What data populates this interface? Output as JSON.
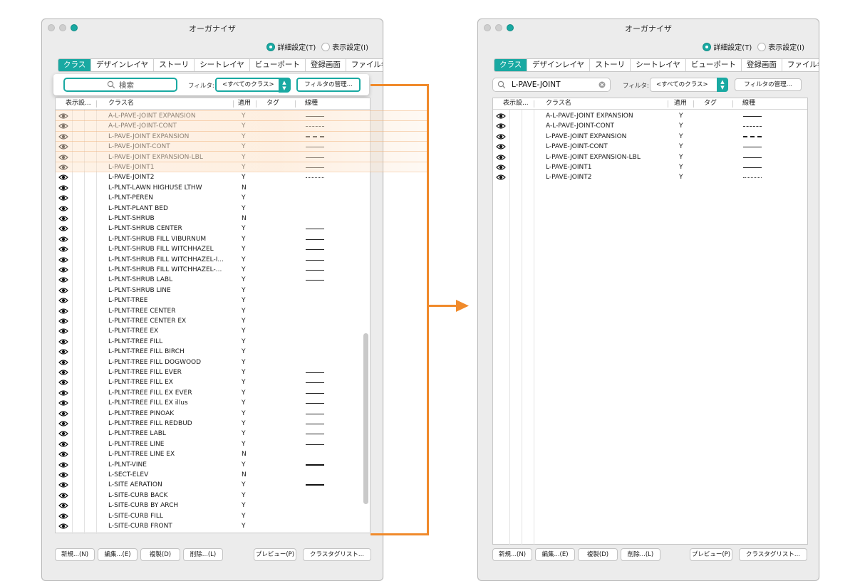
{
  "window_title": "オーガナイザ",
  "radio": {
    "detail": "詳細設定(T)",
    "display": "表示設定(I)"
  },
  "tabs": [
    "クラス",
    "デザインレイヤ",
    "ストーリ",
    "シートレイヤ",
    "ビューポート",
    "登録画面",
    "ファイル参照"
  ],
  "left": {
    "search_placeholder": "検索",
    "filter_label": "フィルタ:",
    "filter_value": "<すべてのクラス>",
    "manage_filter": "フィルタの管理...",
    "columns": {
      "visibility": "表示設...",
      "name": "クラス名",
      "apply": "適用",
      "tag": "タグ",
      "linetype": "線種"
    },
    "rows": [
      {
        "name": "A-L-PAVE-JOINT EXPANSION",
        "apply": "Y",
        "line": "solid"
      },
      {
        "name": "A-L-PAVE-JOINT-CONT",
        "apply": "Y",
        "line": "dash"
      },
      {
        "name": "L-PAVE-JOINT EXPANSION",
        "apply": "Y",
        "line": "dashb"
      },
      {
        "name": "L-PAVE-JOINT-CONT",
        "apply": "Y",
        "line": "solid"
      },
      {
        "name": "L-PAVE-JOINT EXPANSION-LBL",
        "apply": "Y",
        "line": "solid"
      },
      {
        "name": "L-PAVE-JOINT1",
        "apply": "Y",
        "line": "solid"
      },
      {
        "name": "L-PAVE-JOINT2",
        "apply": "Y",
        "line": "dot"
      },
      {
        "name": "L-PLNT-LAWN HIGHUSE LTHW",
        "apply": "N",
        "line": ""
      },
      {
        "name": "L-PLNT-PEREN",
        "apply": "Y",
        "line": ""
      },
      {
        "name": "L-PLNT-PLANT BED",
        "apply": "Y",
        "line": ""
      },
      {
        "name": "L-PLNT-SHRUB",
        "apply": "N",
        "line": ""
      },
      {
        "name": "L-PLNT-SHRUB CENTER",
        "apply": "Y",
        "line": "solid"
      },
      {
        "name": "L-PLNT-SHRUB FILL VIBURNUM",
        "apply": "Y",
        "line": "solid"
      },
      {
        "name": "L-PLNT-SHRUB FILL WITCHHAZEL",
        "apply": "Y",
        "line": "solid"
      },
      {
        "name": "L-PLNT-SHRUB FILL WITCHHAZEL-I...",
        "apply": "Y",
        "line": "solid"
      },
      {
        "name": "L-PLNT-SHRUB FILL WITCHHAZEL-...",
        "apply": "Y",
        "line": "solid"
      },
      {
        "name": "L-PLNT-SHRUB LABL",
        "apply": "Y",
        "line": "solid"
      },
      {
        "name": "L-PLNT-SHRUB LINE",
        "apply": "Y",
        "line": ""
      },
      {
        "name": "L-PLNT-TREE",
        "apply": "Y",
        "line": ""
      },
      {
        "name": "L-PLNT-TREE CENTER",
        "apply": "Y",
        "line": ""
      },
      {
        "name": "L-PLNT-TREE CENTER EX",
        "apply": "Y",
        "line": ""
      },
      {
        "name": "L-PLNT-TREE EX",
        "apply": "Y",
        "line": ""
      },
      {
        "name": "L-PLNT-TREE FILL",
        "apply": "Y",
        "line": ""
      },
      {
        "name": "L-PLNT-TREE FILL BIRCH",
        "apply": "Y",
        "line": ""
      },
      {
        "name": "L-PLNT-TREE FILL DOGWOOD",
        "apply": "Y",
        "line": ""
      },
      {
        "name": "L-PLNT-TREE FILL EVER",
        "apply": "Y",
        "line": "solid"
      },
      {
        "name": "L-PLNT-TREE FILL EX",
        "apply": "Y",
        "line": "solid"
      },
      {
        "name": "L-PLNT-TREE FILL EX EVER",
        "apply": "Y",
        "line": "solid"
      },
      {
        "name": "L-PLNT-TREE FILL EX illus",
        "apply": "Y",
        "line": "solid"
      },
      {
        "name": "L-PLNT-TREE PINOAK",
        "apply": "Y",
        "line": "solid"
      },
      {
        "name": "L-PLNT-TREE FILL REDBUD",
        "apply": "Y",
        "line": "solid"
      },
      {
        "name": "L-PLNT-TREE LABL",
        "apply": "Y",
        "line": "solid"
      },
      {
        "name": "L-PLNT-TREE LINE",
        "apply": "Y",
        "line": "solid"
      },
      {
        "name": "L-PLNT-TREE LINE EX",
        "apply": "N",
        "line": ""
      },
      {
        "name": "L-PLNT-VINE",
        "apply": "Y",
        "line": "thick"
      },
      {
        "name": "L-SECT-ELEV",
        "apply": "N",
        "line": ""
      },
      {
        "name": "L-SITE AERATION",
        "apply": "Y",
        "line": "thick"
      },
      {
        "name": "L-SITE-CURB BACK",
        "apply": "Y",
        "line": ""
      },
      {
        "name": "L-SITE-CURB BY ARCH",
        "apply": "Y",
        "line": ""
      },
      {
        "name": "L-SITE-CURB FILL",
        "apply": "Y",
        "line": ""
      },
      {
        "name": "L-SITE-CURB FRONT",
        "apply": "Y",
        "line": ""
      }
    ]
  },
  "right": {
    "search_value": "L-PAVE-JOINT",
    "filter_label": "フィルタ:",
    "filter_value": "<すべてのクラス>",
    "manage_filter": "フィルタの管理...",
    "columns": {
      "visibility": "表示設...",
      "name": "クラス名",
      "apply": "適用",
      "tag": "タグ",
      "linetype": "線種"
    },
    "rows": [
      {
        "name": "A-L-PAVE-JOINT EXPANSION",
        "apply": "Y",
        "line": "solid"
      },
      {
        "name": "A-L-PAVE-JOINT-CONT",
        "apply": "Y",
        "line": "dash"
      },
      {
        "name": "L-PAVE-JOINT EXPANSION",
        "apply": "Y",
        "line": "dashb"
      },
      {
        "name": "L-PAVE-JOINT-CONT",
        "apply": "Y",
        "line": "solid"
      },
      {
        "name": "L-PAVE-JOINT EXPANSION-LBL",
        "apply": "Y",
        "line": "solid"
      },
      {
        "name": "L-PAVE-JOINT1",
        "apply": "Y",
        "line": "solid"
      },
      {
        "name": "L-PAVE-JOINT2",
        "apply": "Y",
        "line": "dot"
      }
    ]
  },
  "buttons": {
    "new": "新規...(N)",
    "edit": "編集...(E)",
    "duplicate": "複製(D)",
    "delete": "削除...(L)",
    "preview": "プレビュー(P)",
    "tag_list": "クラスタグリスト..."
  },
  "colors": {
    "accent": "#19a9a2",
    "connector": "#f08a2b",
    "highlight": "#fce2c8"
  }
}
